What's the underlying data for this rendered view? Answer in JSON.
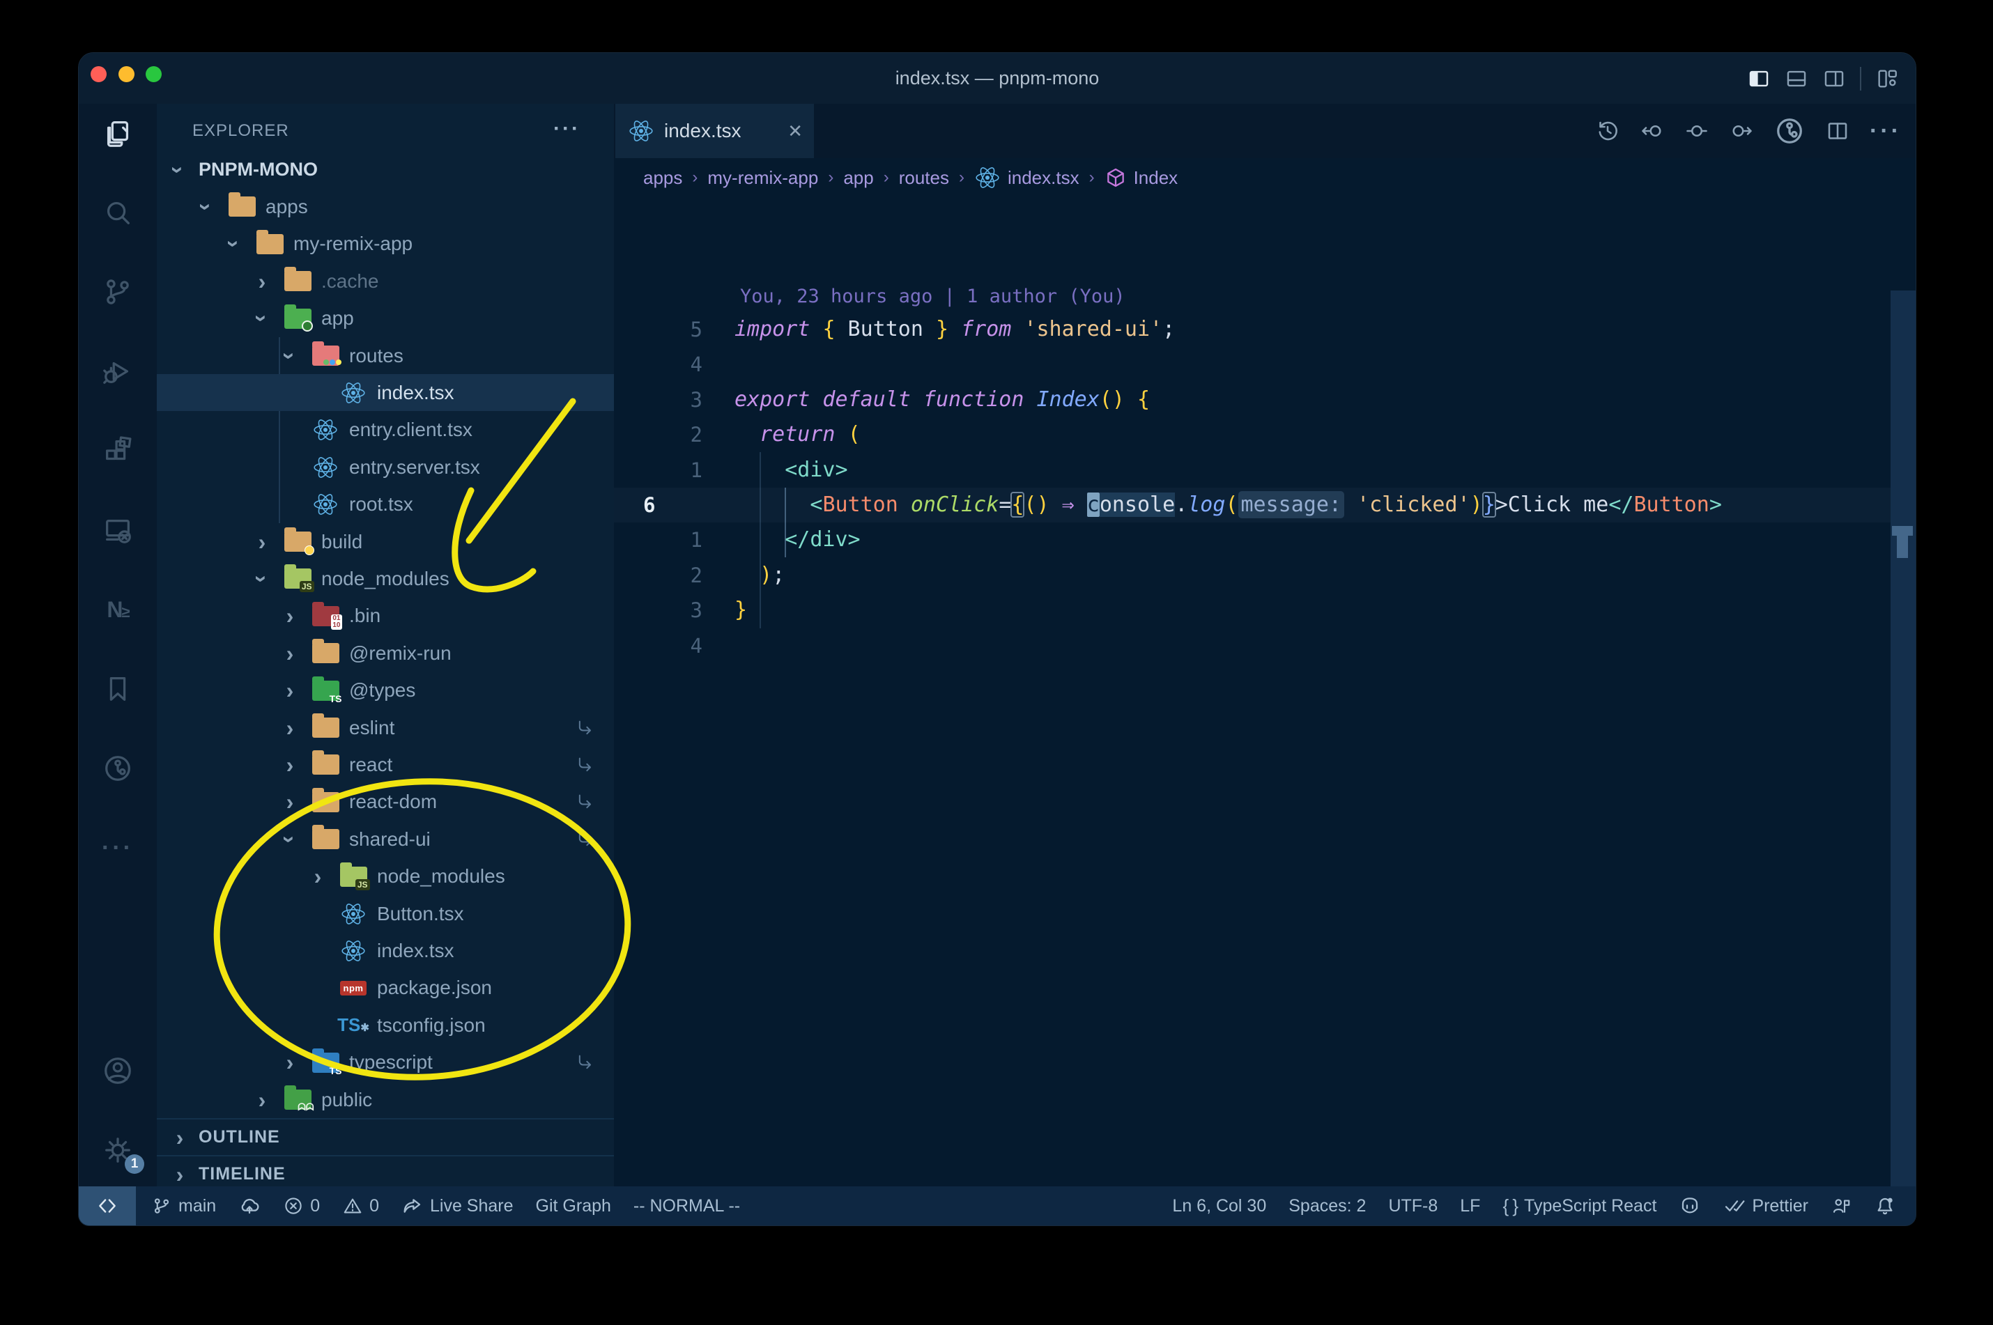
{
  "window": {
    "title": "index.tsx — pnpm-mono"
  },
  "title_bar": {
    "traffic_lights": [
      "close",
      "minimize",
      "zoom"
    ],
    "layout_icons": [
      "toggle-primary-sidebar",
      "toggle-panel",
      "toggle-secondary-sidebar",
      "customize-layout"
    ]
  },
  "activity_bar": {
    "items": [
      {
        "name": "explorer",
        "icon": "files",
        "active": true
      },
      {
        "name": "search",
        "icon": "search",
        "active": false
      },
      {
        "name": "source-control",
        "icon": "git-branch",
        "active": false
      },
      {
        "name": "run-debug",
        "icon": "debug",
        "active": false
      },
      {
        "name": "extensions",
        "icon": "extensions",
        "active": false
      },
      {
        "name": "remote-explorer",
        "icon": "remote-monitor",
        "active": false
      },
      {
        "name": "nx-console",
        "icon": "nx",
        "active": false
      },
      {
        "name": "bookmarks",
        "icon": "bookmark",
        "active": false
      },
      {
        "name": "git-graph",
        "icon": "git-circle",
        "active": false
      },
      {
        "name": "more-views",
        "icon": "ellipsis",
        "active": false
      }
    ],
    "bottom": [
      {
        "name": "accounts",
        "icon": "account"
      },
      {
        "name": "settings",
        "icon": "gear",
        "badge": "1"
      }
    ]
  },
  "sidebar": {
    "header": "EXPLORER",
    "more_label": "···",
    "tree": [
      {
        "label": "PNPM-MONO",
        "depth": 0,
        "kind": "root",
        "expanded": true
      },
      {
        "label": "apps",
        "depth": 1,
        "icon": "folder-tan",
        "expanded": true
      },
      {
        "label": "my-remix-app",
        "depth": 2,
        "icon": "folder-tan",
        "expanded": true
      },
      {
        "label": ".cache",
        "depth": 3,
        "icon": "folder-tan",
        "expanded": false,
        "dim": true
      },
      {
        "label": "app",
        "depth": 3,
        "icon": "folder-app",
        "expanded": true
      },
      {
        "label": "routes",
        "depth": 4,
        "icon": "folder-routes",
        "expanded": true
      },
      {
        "label": "index.tsx",
        "depth": 5,
        "icon": "react",
        "selected": true
      },
      {
        "label": "entry.client.tsx",
        "depth": 4,
        "icon": "react"
      },
      {
        "label": "entry.server.tsx",
        "depth": 4,
        "icon": "react"
      },
      {
        "label": "root.tsx",
        "depth": 4,
        "icon": "react"
      },
      {
        "label": "build",
        "depth": 3,
        "icon": "folder-build",
        "expanded": false
      },
      {
        "label": "node_modules",
        "depth": 3,
        "icon": "folder-node",
        "expanded": true
      },
      {
        "label": ".bin",
        "depth": 4,
        "icon": "folder-bin",
        "expanded": false
      },
      {
        "label": "@remix-run",
        "depth": 4,
        "icon": "folder-tan",
        "expanded": false
      },
      {
        "label": "@types",
        "depth": 4,
        "icon": "folder-types",
        "expanded": false
      },
      {
        "label": "eslint",
        "depth": 4,
        "icon": "folder-tan",
        "expanded": false,
        "symlink": true
      },
      {
        "label": "react",
        "depth": 4,
        "icon": "folder-tan",
        "expanded": false,
        "symlink": true
      },
      {
        "label": "react-dom",
        "depth": 4,
        "icon": "folder-tan",
        "expanded": false,
        "symlink": true
      },
      {
        "label": "shared-ui",
        "depth": 4,
        "icon": "folder-tan",
        "expanded": true,
        "symlink": true
      },
      {
        "label": "node_modules",
        "depth": 5,
        "icon": "folder-node",
        "expanded": false
      },
      {
        "label": "Button.tsx",
        "depth": 5,
        "icon": "react"
      },
      {
        "label": "index.tsx",
        "depth": 5,
        "icon": "react"
      },
      {
        "label": "package.json",
        "depth": 5,
        "icon": "npm"
      },
      {
        "label": "tsconfig.json",
        "depth": 5,
        "icon": "ts-gear"
      },
      {
        "label": "typescript",
        "depth": 4,
        "icon": "folder-ts",
        "expanded": false,
        "symlink": true
      },
      {
        "label": "public",
        "depth": 3,
        "icon": "folder-public",
        "expanded": false
      }
    ],
    "panels": [
      "OUTLINE",
      "TIMELINE"
    ]
  },
  "editor": {
    "tab": {
      "label": "index.tsx",
      "icon": "react",
      "close": "✕"
    },
    "actions": [
      "local-history",
      "open-changes-previous",
      "open-changes",
      "open-changes-next",
      "git-graph",
      "split-editor",
      "more-actions"
    ],
    "breadcrumbs": [
      {
        "text": "apps"
      },
      {
        "text": "my-remix-app"
      },
      {
        "text": "app"
      },
      {
        "text": "routes"
      },
      {
        "text": "index.tsx",
        "icon": "react"
      },
      {
        "text": "Index",
        "icon": "symbol-cube"
      }
    ],
    "gitlens_annotation": "You, 23 hours ago | 1 author (You)",
    "code_lines": [
      {
        "num": "5",
        "tokens": [
          [
            "k",
            "import "
          ],
          [
            "b",
            "{"
          ],
          [
            "p",
            " Button "
          ],
          [
            "b",
            "}"
          ],
          [
            "k",
            " from "
          ],
          [
            "s",
            "'shared-ui'"
          ],
          [
            "p",
            ";"
          ]
        ]
      },
      {
        "num": "4",
        "tokens": []
      },
      {
        "num": "3",
        "tokens": [
          [
            "k",
            "export default function "
          ],
          [
            "fn",
            "Index"
          ],
          [
            "b",
            "()"
          ],
          [
            "p",
            " "
          ],
          [
            "b",
            "{"
          ]
        ]
      },
      {
        "num": "2",
        "tokens": [
          [
            "p",
            "  "
          ],
          [
            "k",
            "return "
          ],
          [
            "b",
            "("
          ]
        ]
      },
      {
        "num": "1",
        "tokens": [
          [
            "p",
            "    "
          ],
          [
            "t",
            "<div>"
          ]
        ]
      },
      {
        "num": "6",
        "current": true,
        "tokens": [
          [
            "p",
            "      "
          ],
          [
            "t",
            "<"
          ],
          [
            "cmp",
            "Button"
          ],
          [
            "p",
            " "
          ],
          [
            "attr",
            "onClick"
          ],
          [
            "p",
            "="
          ],
          [
            "bx",
            "{"
          ],
          [
            "b",
            "()"
          ],
          [
            "p",
            " "
          ],
          [
            "ar",
            "⇒"
          ],
          [
            "p",
            " "
          ],
          [
            "cur",
            "c"
          ],
          [
            "sel",
            "onsole"
          ],
          [
            "p",
            "."
          ],
          [
            "fn",
            "log"
          ],
          [
            "b",
            "("
          ],
          [
            "inlay",
            "message:"
          ],
          [
            "p",
            " "
          ],
          [
            "s",
            "'clicked'"
          ],
          [
            "b",
            ")"
          ],
          [
            "fx",
            "}"
          ],
          [
            "p",
            ">Click me"
          ],
          [
            "t",
            "</"
          ],
          [
            "cmp",
            "Button"
          ],
          [
            "t",
            ">"
          ]
        ]
      },
      {
        "num": "1",
        "tokens": [
          [
            "p",
            "    "
          ],
          [
            "t",
            "</div>"
          ]
        ]
      },
      {
        "num": "2",
        "tokens": [
          [
            "p",
            "  "
          ],
          [
            "b",
            ")"
          ],
          [
            "p",
            ";"
          ]
        ]
      },
      {
        "num": "3",
        "tokens": [
          [
            "b",
            "}"
          ]
        ]
      },
      {
        "num": "4",
        "tokens": []
      }
    ]
  },
  "status_bar": {
    "left": [
      {
        "name": "branch",
        "icon": "branch",
        "text": "main"
      },
      {
        "name": "sync",
        "icon": "cloud-upload",
        "text": ""
      },
      {
        "name": "errors",
        "icon": "error-circle",
        "text": "0"
      },
      {
        "name": "warnings",
        "icon": "warning-triangle",
        "text": "0"
      },
      {
        "name": "live-share",
        "icon": "share",
        "text": "Live Share"
      },
      {
        "name": "git-graph",
        "icon": "",
        "text": "Git Graph"
      },
      {
        "name": "vim-mode",
        "icon": "",
        "text": "-- NORMAL --"
      }
    ],
    "right": [
      {
        "name": "cursor-position",
        "icon": "",
        "text": "Ln 6, Col 30"
      },
      {
        "name": "indentation",
        "icon": "",
        "text": "Spaces: 2"
      },
      {
        "name": "encoding",
        "icon": "",
        "text": "UTF-8"
      },
      {
        "name": "eol",
        "icon": "",
        "text": "LF"
      },
      {
        "name": "language-mode",
        "icon": "braces",
        "text": "TypeScript React"
      },
      {
        "name": "copilot",
        "icon": "copilot",
        "text": ""
      },
      {
        "name": "prettier",
        "icon": "double-check",
        "text": "Prettier"
      },
      {
        "name": "feedback",
        "icon": "person-flag",
        "text": ""
      },
      {
        "name": "notifications",
        "icon": "bell",
        "text": ""
      }
    ]
  },
  "annotations": {
    "arrow_target": "node_modules",
    "ellipse_target": "shared-ui contents",
    "color": "#f1e511"
  },
  "colors": {
    "traffic_red": "#ff5f57",
    "traffic_yellow": "#febc2e",
    "traffic_green": "#29c73f",
    "react_blue": "#5fb2e6",
    "folder_tan": "#d8a868",
    "keyword_purple": "#c792ea",
    "string_orange": "#ecc48d",
    "tag_teal": "#7fdbca",
    "component_salmon": "#f78c6c",
    "bracket_gold": "#ffd23f",
    "breadcrumb_lavender": "#a89ae0"
  }
}
